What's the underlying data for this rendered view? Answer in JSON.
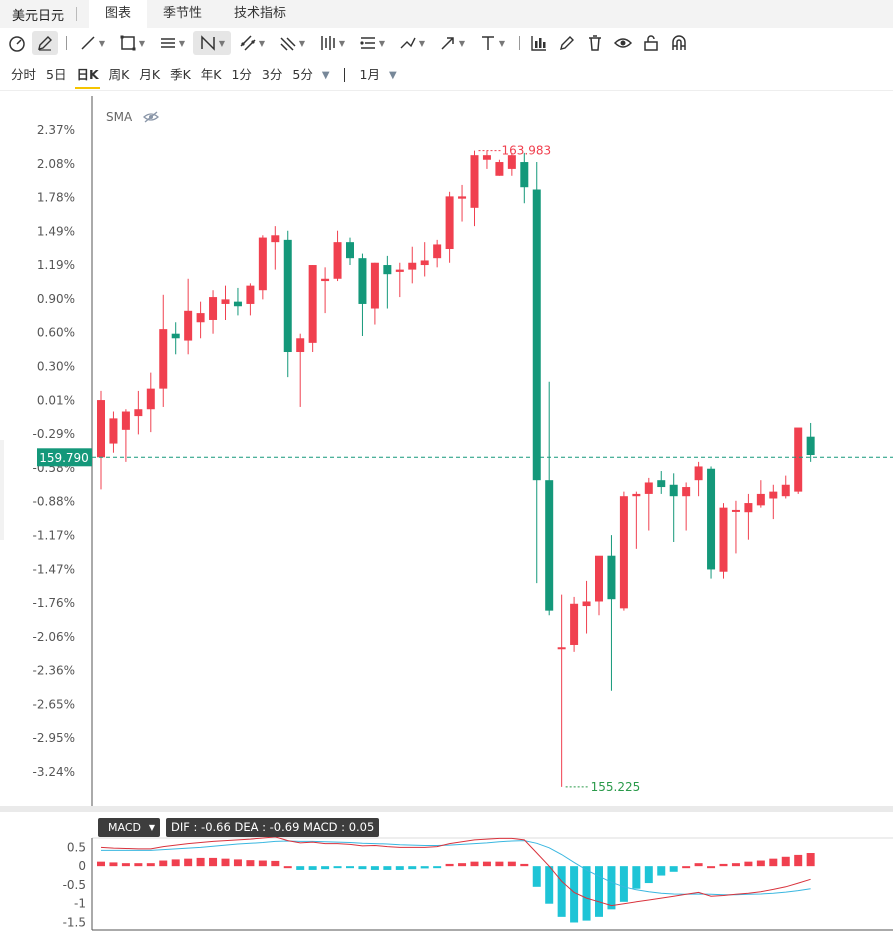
{
  "tabbar": {
    "title": "美元日元",
    "tabs": [
      {
        "label": "图表",
        "active": true
      },
      {
        "label": "季节性",
        "active": false
      },
      {
        "label": "技术指标",
        "active": false
      }
    ]
  },
  "toolbar_icons": [
    "gauge-icon",
    "pencil-icon",
    "line-icon",
    "rectangle-icon",
    "fib-icon",
    "pattern-icon",
    "channel-icon",
    "gann-icon",
    "bars-icon",
    "measure-icon",
    "brush-icon",
    "arrow-icon",
    "text-icon",
    "indicator-icon",
    "edit-icon",
    "trash-icon",
    "eye-icon",
    "lock-icon",
    "magnet-icon"
  ],
  "periods": [
    {
      "label": "分时",
      "active": false
    },
    {
      "label": "5日",
      "active": false
    },
    {
      "label": "日K",
      "active": true
    },
    {
      "label": "周K",
      "active": false
    },
    {
      "label": "月K",
      "active": false
    },
    {
      "label": "季K",
      "active": false
    },
    {
      "label": "年K",
      "active": false
    },
    {
      "label": "1分",
      "active": false
    },
    {
      "label": "3分",
      "active": false
    },
    {
      "label": "5分",
      "active": false
    }
  ],
  "range_label": "1月",
  "indicator_label": "SMA",
  "macd": {
    "label": "MACD",
    "values_text": "DIF : -0.66   DEA : -0.69   MACD : 0.05"
  },
  "colors": {
    "up": "#f0404f",
    "down": "#14987a",
    "dif": "#d9323c",
    "dea": "#3ab7e0",
    "hist_up": "#f0404f",
    "hist_down": "#1ec4d6"
  },
  "chart_data": {
    "type": "candlestick",
    "y_ticks": [
      "2.37%",
      "2.08%",
      "1.78%",
      "1.49%",
      "1.19%",
      "0.90%",
      "0.60%",
      "0.30%",
      "0.01%",
      "-0.29%",
      "-0.58%",
      "-0.88%",
      "-1.17%",
      "-1.47%",
      "-1.76%",
      "-2.06%",
      "-2.36%",
      "-2.65%",
      "-2.95%",
      "-3.24%"
    ],
    "ylim_pct": [
      -3.24,
      2.37
    ],
    "current_price": "159.790",
    "current_pct": -0.49,
    "max_label": "163.983",
    "min_label": "155.225",
    "candles": [
      {
        "o": -0.49,
        "h": 0.09,
        "l": -0.77,
        "c": 0.01
      },
      {
        "o": -0.37,
        "h": -0.09,
        "l": -0.45,
        "c": -0.15
      },
      {
        "o": -0.25,
        "h": -0.07,
        "l": -0.53,
        "c": -0.09
      },
      {
        "o": -0.13,
        "h": 0.09,
        "l": -0.29,
        "c": -0.07
      },
      {
        "o": -0.07,
        "h": 0.25,
        "l": -0.27,
        "c": 0.11
      },
      {
        "o": 0.11,
        "h": 0.93,
        "l": -0.05,
        "c": 0.63
      },
      {
        "o": 0.59,
        "h": 0.69,
        "l": 0.41,
        "c": 0.55
      },
      {
        "o": 0.53,
        "h": 1.07,
        "l": 0.41,
        "c": 0.79
      },
      {
        "o": 0.69,
        "h": 0.87,
        "l": 0.55,
        "c": 0.77
      },
      {
        "o": 0.71,
        "h": 0.97,
        "l": 0.59,
        "c": 0.91
      },
      {
        "o": 0.85,
        "h": 1.01,
        "l": 0.71,
        "c": 0.89
      },
      {
        "o": 0.87,
        "h": 0.99,
        "l": 0.75,
        "c": 0.83
      },
      {
        "o": 0.85,
        "h": 1.03,
        "l": 0.75,
        "c": 1.01
      },
      {
        "o": 0.97,
        "h": 1.45,
        "l": 0.89,
        "c": 1.43
      },
      {
        "o": 1.39,
        "h": 1.53,
        "l": 1.15,
        "c": 1.45
      },
      {
        "o": 1.41,
        "h": 1.49,
        "l": 0.21,
        "c": 0.43
      },
      {
        "o": 0.43,
        "h": 0.59,
        "l": -0.05,
        "c": 0.55
      },
      {
        "o": 0.51,
        "h": 1.19,
        "l": 0.43,
        "c": 1.19
      },
      {
        "o": 1.05,
        "h": 1.17,
        "l": 0.77,
        "c": 1.07
      },
      {
        "o": 1.07,
        "h": 1.49,
        "l": 1.05,
        "c": 1.39
      },
      {
        "o": 1.39,
        "h": 1.43,
        "l": 1.19,
        "c": 1.25
      },
      {
        "o": 1.25,
        "h": 1.29,
        "l": 0.57,
        "c": 0.85
      },
      {
        "o": 0.81,
        "h": 1.21,
        "l": 0.67,
        "c": 1.21
      },
      {
        "o": 1.19,
        "h": 1.27,
        "l": 0.81,
        "c": 1.11
      },
      {
        "o": 1.13,
        "h": 1.21,
        "l": 0.91,
        "c": 1.15
      },
      {
        "o": 1.15,
        "h": 1.35,
        "l": 1.03,
        "c": 1.21
      },
      {
        "o": 1.19,
        "h": 1.39,
        "l": 1.09,
        "c": 1.23
      },
      {
        "o": 1.25,
        "h": 1.41,
        "l": 1.17,
        "c": 1.37
      },
      {
        "o": 1.33,
        "h": 1.83,
        "l": 1.21,
        "c": 1.79
      },
      {
        "o": 1.77,
        "h": 1.89,
        "l": 1.57,
        "c": 1.79
      },
      {
        "o": 1.69,
        "h": 2.19,
        "l": 1.53,
        "c": 2.15
      },
      {
        "o": 2.11,
        "h": 2.19,
        "l": 2.03,
        "c": 2.15
      },
      {
        "o": 1.97,
        "h": 2.11,
        "l": 1.97,
        "c": 2.09
      },
      {
        "o": 2.03,
        "h": 2.17,
        "l": 1.97,
        "c": 2.15
      },
      {
        "o": 2.09,
        "h": 2.17,
        "l": 1.73,
        "c": 1.87
      },
      {
        "o": 1.85,
        "h": 2.09,
        "l": -1.59,
        "c": -0.69
      },
      {
        "o": -0.69,
        "h": 0.17,
        "l": -1.87,
        "c": -1.83
      },
      {
        "o": -2.15,
        "h": -1.69,
        "l": -3.37,
        "c": -2.15
      },
      {
        "o": -2.13,
        "h": -1.71,
        "l": -2.19,
        "c": -1.77
      },
      {
        "o": -1.79,
        "h": -1.57,
        "l": -2.03,
        "c": -1.75
      },
      {
        "o": -1.75,
        "h": -1.45,
        "l": -1.87,
        "c": -1.35
      },
      {
        "o": -1.35,
        "h": -1.17,
        "l": -2.53,
        "c": -1.73
      },
      {
        "o": -1.81,
        "h": -0.79,
        "l": -1.83,
        "c": -0.83
      },
      {
        "o": -0.83,
        "h": -0.79,
        "l": -1.29,
        "c": -0.81
      },
      {
        "o": -0.81,
        "h": -0.67,
        "l": -1.13,
        "c": -0.71
      },
      {
        "o": -0.69,
        "h": -0.61,
        "l": -0.81,
        "c": -0.75
      },
      {
        "o": -0.73,
        "h": -0.63,
        "l": -1.23,
        "c": -0.83
      },
      {
        "o": -0.83,
        "h": -0.71,
        "l": -1.13,
        "c": -0.75
      },
      {
        "o": -0.69,
        "h": -0.53,
        "l": -0.83,
        "c": -0.57
      },
      {
        "o": -0.59,
        "h": -0.57,
        "l": -1.55,
        "c": -1.47
      },
      {
        "o": -1.49,
        "h": -0.89,
        "l": -1.55,
        "c": -0.93
      },
      {
        "o": -0.95,
        "h": -0.87,
        "l": -1.33,
        "c": -0.95
      },
      {
        "o": -0.97,
        "h": -0.81,
        "l": -1.21,
        "c": -0.89
      },
      {
        "o": -0.91,
        "h": -0.69,
        "l": -0.93,
        "c": -0.81
      },
      {
        "o": -0.85,
        "h": -0.73,
        "l": -1.03,
        "c": -0.79
      },
      {
        "o": -0.83,
        "h": -0.65,
        "l": -0.85,
        "c": -0.73
      },
      {
        "o": -0.79,
        "h": -0.57,
        "l": -0.81,
        "c": -0.23
      },
      {
        "o": -0.31,
        "h": -0.19,
        "l": -0.53,
        "c": -0.47
      }
    ],
    "macd_ticks": [
      "0.5",
      "0",
      "-0.5",
      "-1",
      "-1.5"
    ],
    "macd_ylim": [
      -1.7,
      0.75
    ],
    "macd_hist": [
      0.12,
      0.1,
      0.08,
      0.08,
      0.08,
      0.15,
      0.18,
      0.2,
      0.22,
      0.22,
      0.2,
      0.18,
      0.16,
      0.15,
      0.14,
      0,
      -0.1,
      -0.1,
      -0.08,
      -0.05,
      -0.05,
      -0.08,
      -0.1,
      -0.1,
      -0.1,
      -0.08,
      -0.06,
      -0.05,
      0.06,
      0.08,
      0.12,
      0.12,
      0.12,
      0.12,
      0.06,
      -0.55,
      -1.0,
      -1.35,
      -1.5,
      -1.45,
      -1.35,
      -1.15,
      -0.95,
      -0.6,
      -0.45,
      -0.25,
      -0.15,
      0,
      0.08,
      0,
      0.06,
      0.08,
      0.12,
      0.15,
      0.2,
      0.25,
      0.3,
      0.35
    ],
    "macd_dif": [
      0.5,
      0.48,
      0.47,
      0.46,
      0.46,
      0.52,
      0.56,
      0.6,
      0.63,
      0.66,
      0.68,
      0.7,
      0.72,
      0.75,
      0.78,
      0.68,
      0.62,
      0.64,
      0.6,
      0.6,
      0.58,
      0.54,
      0.55,
      0.52,
      0.5,
      0.5,
      0.5,
      0.52,
      0.6,
      0.65,
      0.7,
      0.72,
      0.74,
      0.74,
      0.7,
      0.35,
      0.0,
      -0.4,
      -0.7,
      -0.85,
      -0.95,
      -1.05,
      -1.0,
      -0.95,
      -0.9,
      -0.85,
      -0.8,
      -0.75,
      -0.7,
      -0.8,
      -0.78,
      -0.75,
      -0.72,
      -0.68,
      -0.62,
      -0.55,
      -0.45,
      -0.35
    ],
    "macd_dea": [
      0.42,
      0.42,
      0.42,
      0.42,
      0.42,
      0.44,
      0.46,
      0.48,
      0.5,
      0.53,
      0.56,
      0.59,
      0.61,
      0.63,
      0.66,
      0.67,
      0.66,
      0.66,
      0.65,
      0.64,
      0.63,
      0.61,
      0.6,
      0.59,
      0.57,
      0.56,
      0.55,
      0.55,
      0.56,
      0.58,
      0.6,
      0.62,
      0.65,
      0.67,
      0.68,
      0.61,
      0.49,
      0.31,
      0.1,
      -0.1,
      -0.27,
      -0.43,
      -0.55,
      -0.63,
      -0.68,
      -0.72,
      -0.74,
      -0.75,
      -0.74,
      -0.75,
      -0.76,
      -0.76,
      -0.75,
      -0.74,
      -0.72,
      -0.69,
      -0.65,
      -0.6
    ]
  }
}
